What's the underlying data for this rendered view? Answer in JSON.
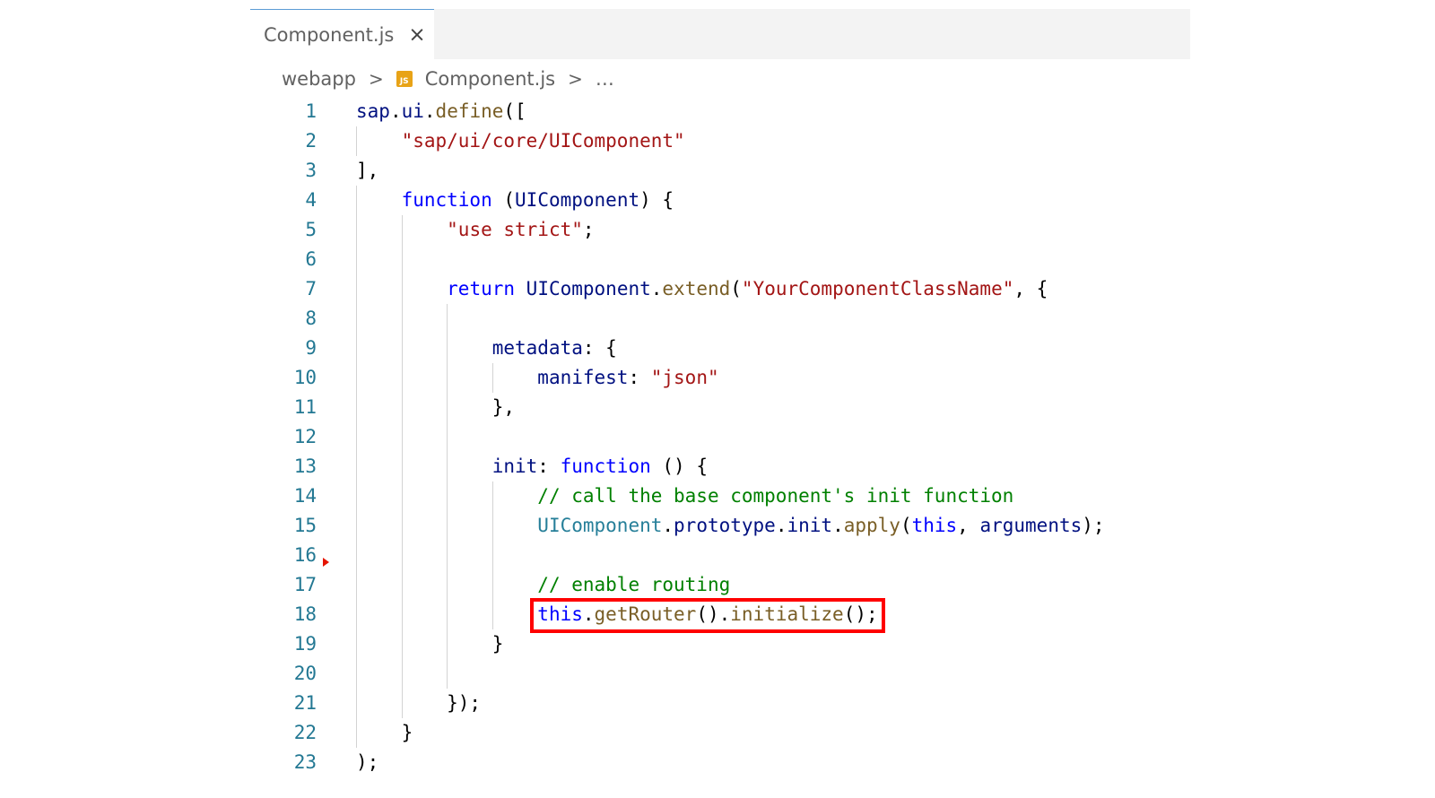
{
  "tab": {
    "label": "Component.js",
    "close_glyph": "×"
  },
  "breadcrumb": {
    "folder": "webapp",
    "file": "Component.js",
    "more": "…",
    "sep": ">"
  },
  "code": {
    "lines": [
      {
        "n": "1",
        "text": "sap.ui.define(["
      },
      {
        "n": "2",
        "text": "    \"sap/ui/core/UIComponent\""
      },
      {
        "n": "3",
        "text": "],"
      },
      {
        "n": "4",
        "text": "    function (UIComponent) {"
      },
      {
        "n": "5",
        "text": "        \"use strict\";"
      },
      {
        "n": "6",
        "text": ""
      },
      {
        "n": "7",
        "text": "        return UIComponent.extend(\"YourComponentClassName\", {"
      },
      {
        "n": "8",
        "text": ""
      },
      {
        "n": "9",
        "text": "            metadata: {"
      },
      {
        "n": "10",
        "text": "                manifest: \"json\""
      },
      {
        "n": "11",
        "text": "            },"
      },
      {
        "n": "12",
        "text": ""
      },
      {
        "n": "13",
        "text": "            init: function () {"
      },
      {
        "n": "14",
        "text": "                // call the base component's init function"
      },
      {
        "n": "15",
        "text": "                UIComponent.prototype.init.apply(this, arguments);"
      },
      {
        "n": "16",
        "text": ""
      },
      {
        "n": "17",
        "text": "                // enable routing"
      },
      {
        "n": "18",
        "text": "                this.getRouter().initialize();"
      },
      {
        "n": "19",
        "text": "            }"
      },
      {
        "n": "20",
        "text": ""
      },
      {
        "n": "21",
        "text": "        });"
      },
      {
        "n": "22",
        "text": "    }"
      },
      {
        "n": "23",
        "text": ");"
      }
    ],
    "highlighted_line": "18"
  },
  "colors": {
    "keyword": "#0000ff",
    "string": "#a31515",
    "comment": "#008000",
    "function": "#795e26",
    "variable": "#001080",
    "type": "#267f99",
    "line_number": "#237893",
    "highlight_border": "#ff0000"
  },
  "icons": {
    "close": "close-icon",
    "chevron": "chevron-right-icon",
    "js_file": "js-file-icon",
    "js_file_text": "JS"
  }
}
